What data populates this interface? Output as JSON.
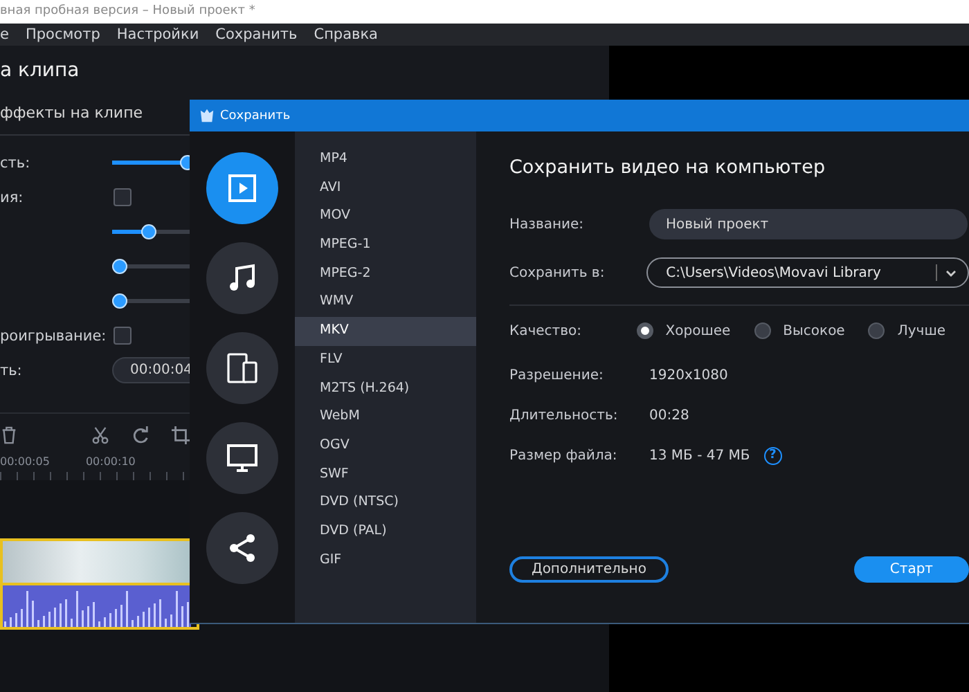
{
  "app": {
    "title": "вная пробная версия – Новый проект *",
    "menu": [
      "е",
      "Просмотр",
      "Настройки",
      "Сохранить",
      "Справка"
    ],
    "panel_title": "а клипа",
    "panel_tab": "ффекты на клипе",
    "properties": [
      {
        "kind": "slider",
        "label": "сть:",
        "level": 0.45
      },
      {
        "kind": "checkbox",
        "label": "ия:",
        "checked": false
      },
      {
        "kind": "slider",
        "level": 0.19
      },
      {
        "kind": "slider",
        "level": 0
      },
      {
        "kind": "slider",
        "level": 0
      },
      {
        "kind": "checkbox",
        "label": "роигрывание:",
        "checked": false
      },
      {
        "kind": "field",
        "label": "ть:",
        "value": "00:00:04"
      }
    ],
    "ruler": [
      "00:00:05",
      "00:00:10"
    ]
  },
  "dialog": {
    "title": "Сохранить",
    "categories": [
      {
        "kind": "video",
        "selected": true
      },
      {
        "kind": "audio",
        "selected": false
      },
      {
        "kind": "devices",
        "selected": false
      },
      {
        "kind": "tv",
        "selected": false
      },
      {
        "kind": "share",
        "selected": false
      }
    ],
    "formats": [
      {
        "label": "MP4",
        "selected": false
      },
      {
        "label": "AVI",
        "selected": false
      },
      {
        "label": "MOV",
        "selected": false
      },
      {
        "label": "MPEG-1",
        "selected": false
      },
      {
        "label": "MPEG-2",
        "selected": false
      },
      {
        "label": "WMV",
        "selected": false
      },
      {
        "label": "MKV",
        "selected": true
      },
      {
        "label": "FLV",
        "selected": false
      },
      {
        "label": "M2TS (H.264)",
        "selected": false
      },
      {
        "label": "WebM",
        "selected": false
      },
      {
        "label": "OGV",
        "selected": false
      },
      {
        "label": "SWF",
        "selected": false
      },
      {
        "label": "DVD (NTSC)",
        "selected": false
      },
      {
        "label": "DVD (PAL)",
        "selected": false
      },
      {
        "label": "GIF",
        "selected": false
      }
    ],
    "heading": "Сохранить видео на компьютер",
    "name": {
      "label": "Название:",
      "value": "Новый проект"
    },
    "folder": {
      "label": "Сохранить в:",
      "value": "C:\\Users\\Videos\\Movavi Library"
    },
    "quality": {
      "label": "Качество:",
      "options": [
        {
          "label": "Хорошее",
          "selected": true
        },
        {
          "label": "Высокое",
          "selected": false
        },
        {
          "label": "Лучше",
          "selected": false
        }
      ]
    },
    "info": [
      {
        "label": "Разрешение:",
        "value": "1920x1080"
      },
      {
        "label": "Длительность:",
        "value": "00:28"
      },
      {
        "label": "Размер файла:",
        "value": "13 МБ - 47 МБ",
        "help": "?"
      }
    ],
    "advanced_button": "Дополнительно",
    "start_button": "Старт"
  }
}
